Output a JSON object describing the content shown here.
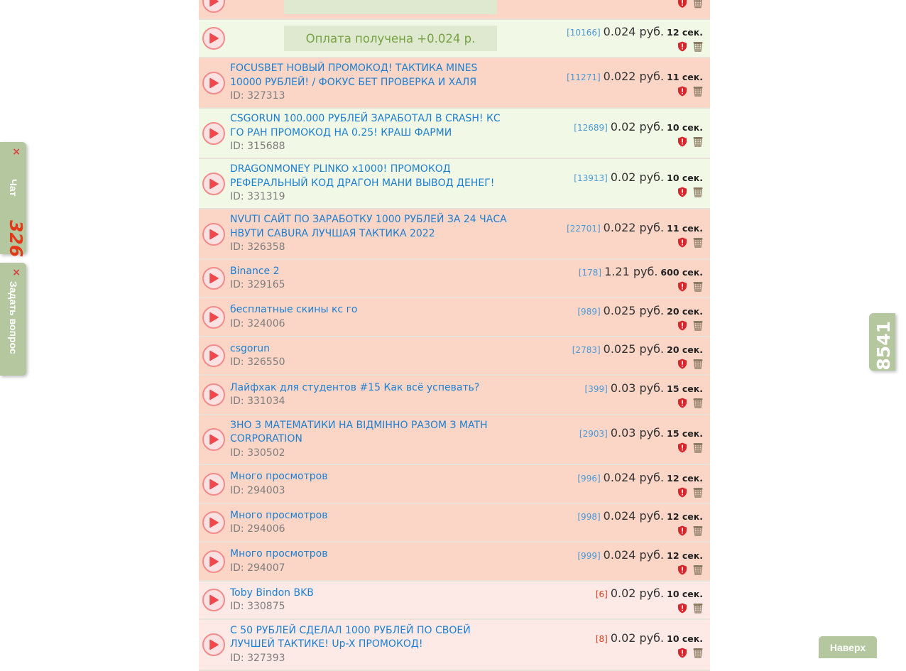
{
  "colors": {
    "row_salmon": "#fbd6c7",
    "row_green": "#f2f8e6",
    "row_pink": "#fdeae6",
    "link": "#1c7fd1",
    "accent_green": "#b5c79f",
    "paid_text": "#77a244",
    "counter_red": "#e2391b"
  },
  "rows": [
    {
      "kind": "paid",
      "color": "salmon",
      "height": 50,
      "paid": "",
      "count": "",
      "price": "",
      "secs": ""
    },
    {
      "kind": "paid",
      "color": "green",
      "height": 54,
      "paid": "Оплата получена +0.024 р.",
      "count": "[10166]",
      "price": "0.024 руб.",
      "secs": "12 сек."
    },
    {
      "kind": "video",
      "color": "salmon",
      "height": 71,
      "title": "FOCUSBET НОВЫЙ ПРОМОКОД! ТАКТИКА MINES 10000 РУБЛЕЙ! / ФОКУС БЕТ ПРОВЕРКА И ХАЛЯ",
      "id": "ID: 327313",
      "count": "[11271]",
      "price": "0.022 руб.",
      "secs": "11 сек."
    },
    {
      "kind": "video",
      "color": "green",
      "height": 71,
      "title": "CSGORUN 100.000 РУБЛЕЙ ЗАРАБОТАЛ В CRASH! КС ГО РАН ПРОМОКОД НА 0.25! КРАШ ФАРМИ",
      "id": "ID: 315688",
      "count": "[12689]",
      "price": "0.02 руб.",
      "secs": "10 сек."
    },
    {
      "kind": "video",
      "color": "green",
      "height": 71,
      "title": "DRAGONMONEY PLINKO x1000! ПРОМОКОД РЕФЕРАЛЬНЫЙ КОД ДРАГОН МАНИ ВЫВОД ДЕНЕГ!",
      "id": "ID: 331319",
      "count": "[13913]",
      "price": "0.02 руб.",
      "secs": "10 сек."
    },
    {
      "kind": "video",
      "color": "salmon",
      "height": 71,
      "title": "NVUTI САЙТ ПО ЗАРАБОТКУ 1000 РУБЛЕЙ ЗА 24 ЧАСА НВУТИ CABURA ЛУЧШАЯ ТАКТИКА 2022",
      "id": "ID: 326358",
      "count": "[22701]",
      "price": "0.022 руб.",
      "secs": "11 сек."
    },
    {
      "kind": "video",
      "color": "salmon",
      "height": 54,
      "title": "Binance 2",
      "id": "ID: 329165",
      "count": "[178]",
      "price": "1.21 руб.",
      "secs": "600 сек."
    },
    {
      "kind": "video",
      "color": "salmon",
      "height": 55,
      "title": "бесплатные скины кс го",
      "id": "ID: 324006",
      "count": "[989]",
      "price": "0.025 руб.",
      "secs": "20 сек."
    },
    {
      "kind": "video",
      "color": "salmon",
      "height": 54,
      "title": "csgorun",
      "id": "ID: 326550",
      "count": "[2783]",
      "price": "0.025 руб.",
      "secs": "20 сек."
    },
    {
      "kind": "video",
      "color": "salmon",
      "height": 56,
      "title": "Лайфхак для студентов #15 Как всё успевать?",
      "id": "ID: 331034",
      "count": "[399]",
      "price": "0.03 руб.",
      "secs": "15 сек."
    },
    {
      "kind": "video",
      "color": "salmon",
      "height": 70,
      "title": "ЗНО З МАТЕМАТИКИ НА ВІДМІННО РАЗОМ З MATH CORPORATION",
      "id": "ID: 330502",
      "count": "[2903]",
      "price": "0.03 руб.",
      "secs": "15 сек."
    },
    {
      "kind": "video",
      "color": "salmon",
      "height": 55,
      "title": "Много просмотров",
      "id": "ID: 294003",
      "count": "[996]",
      "price": "0.024 руб.",
      "secs": "12 сек."
    },
    {
      "kind": "video",
      "color": "salmon",
      "height": 54,
      "title": "Много просмотров",
      "id": "ID: 294006",
      "count": "[998]",
      "price": "0.024 руб.",
      "secs": "12 сек."
    },
    {
      "kind": "video",
      "color": "salmon",
      "height": 55,
      "title": "Много просмотров",
      "id": "ID: 294007",
      "count": "[999]",
      "price": "0.024 руб.",
      "secs": "12 сек."
    },
    {
      "kind": "video",
      "color": "pink",
      "height": 54,
      "title": "Toby Bindon BKB",
      "id": "ID: 330875",
      "count": "[6]",
      "count_red": true,
      "price": "0.02 руб.",
      "secs": "10 сек."
    },
    {
      "kind": "video",
      "color": "pink",
      "height": 72,
      "title": "С 50 РУБЛЕЙ СДЕЛАЛ 1000 РУБЛЕЙ ПО СВОЕЙ ЛУЧШЕЙ ТАКТИКЕ! Up-X ПРОМОКОД!",
      "id": "ID: 327393",
      "count": "[8]",
      "count_red": true,
      "price": "0.02 руб.",
      "secs": "10 сек."
    }
  ],
  "chat_widget": {
    "label": "Чат",
    "count": "326",
    "close": "×"
  },
  "ask_widget": {
    "label": "Задать вопрос",
    "close": "×"
  },
  "online_counter": "8541",
  "scroll_top_label": "Наверх"
}
